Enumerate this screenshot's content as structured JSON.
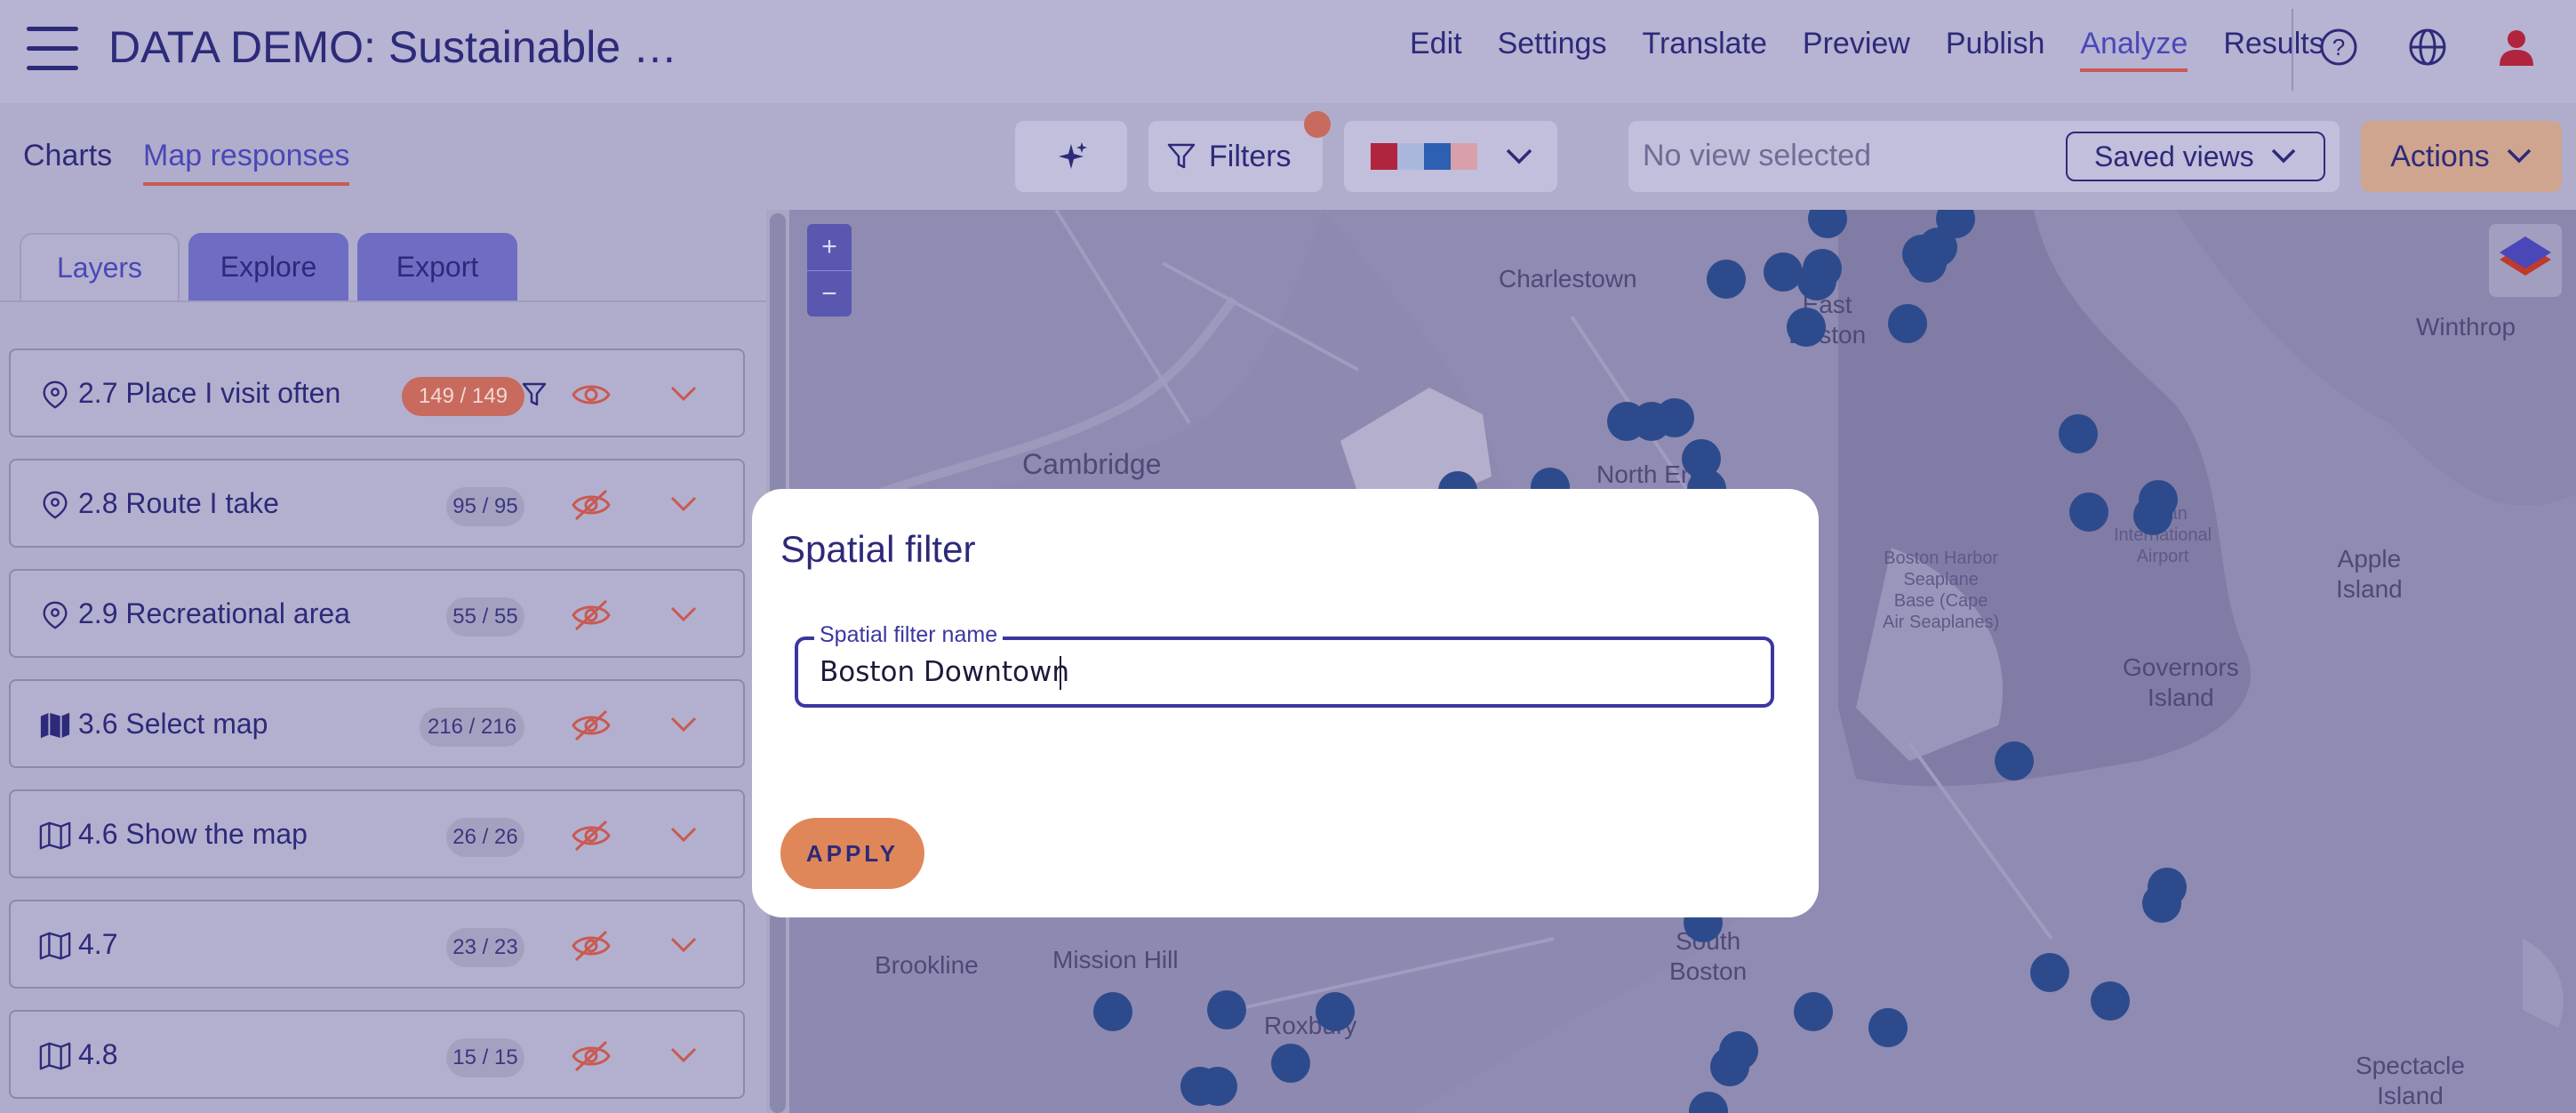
{
  "header": {
    "title": "DATA DEMO: Sustainable …",
    "nav": [
      {
        "label": "Edit",
        "active": false
      },
      {
        "label": "Settings",
        "active": false
      },
      {
        "label": "Translate",
        "active": false
      },
      {
        "label": "Preview",
        "active": false
      },
      {
        "label": "Publish",
        "active": false
      },
      {
        "label": "Analyze",
        "active": true
      },
      {
        "label": "Results",
        "active": false
      }
    ],
    "icons": [
      "help-icon",
      "globe-icon",
      "user-icon"
    ]
  },
  "subbar": {
    "tabs": [
      {
        "label": "Charts",
        "active": false
      },
      {
        "label": "Map responses",
        "active": true
      }
    ],
    "filters_label": "Filters",
    "palette_colors": [
      "#b0253d",
      "#a9b7dc",
      "#2d5fb2",
      "#d8a0aa"
    ],
    "view_placeholder": "No view selected",
    "saved_views_label": "Saved views",
    "actions_label": "Actions"
  },
  "sidebar": {
    "tabs": [
      {
        "label": "Layers",
        "active": true
      },
      {
        "label": "Explore",
        "active": false
      },
      {
        "label": "Export",
        "active": false
      }
    ],
    "layers": [
      {
        "name": "2.7 Place I visit often",
        "count": "149 / 149",
        "icon": "pin-icon",
        "visible": true,
        "filtered": true
      },
      {
        "name": "2.8 Route I take",
        "count": "95 / 95",
        "icon": "pin-icon",
        "visible": false,
        "filtered": false
      },
      {
        "name": "2.9 Recreational area",
        "count": "55 / 55",
        "icon": "pin-icon",
        "visible": false,
        "filtered": false
      },
      {
        "name": "3.6 Select map",
        "count": "216 / 216",
        "icon": "map-filled-icon",
        "visible": false,
        "filtered": false
      },
      {
        "name": "4.6 Show the map",
        "count": "26 / 26",
        "icon": "map-icon",
        "visible": false,
        "filtered": false
      },
      {
        "name": "4.7",
        "count": "23 / 23",
        "icon": "map-icon",
        "visible": false,
        "filtered": false
      },
      {
        "name": "4.8",
        "count": "15 / 15",
        "icon": "map-icon",
        "visible": false,
        "filtered": false
      }
    ]
  },
  "map": {
    "zoom_in": "+",
    "zoom_out": "−",
    "labels": {
      "charlestown": "Charlestown",
      "east_boston": "East\nBoston",
      "winthrop": "Winthrop",
      "cambridge": "Cambridge",
      "north_end": "North End",
      "logan": "Logan\nInternational\nAirport",
      "harbor": "Boston Harbor\nSeaplane\nBase (Cape\nAir Seaplanes)",
      "apple_island": "Apple\nIsland",
      "governors_island": "Governors\nIsland",
      "brookline": "Brookline",
      "mission_hill": "Mission Hill",
      "roxbury": "Roxbury",
      "south_boston": "South\nBoston",
      "spectacle_island": "Spectacle\nIsland"
    }
  },
  "modal": {
    "title": "Spatial filter",
    "field_label": "Spatial filter name",
    "field_value": "Boston Downtown",
    "apply_label": "APPLY"
  }
}
